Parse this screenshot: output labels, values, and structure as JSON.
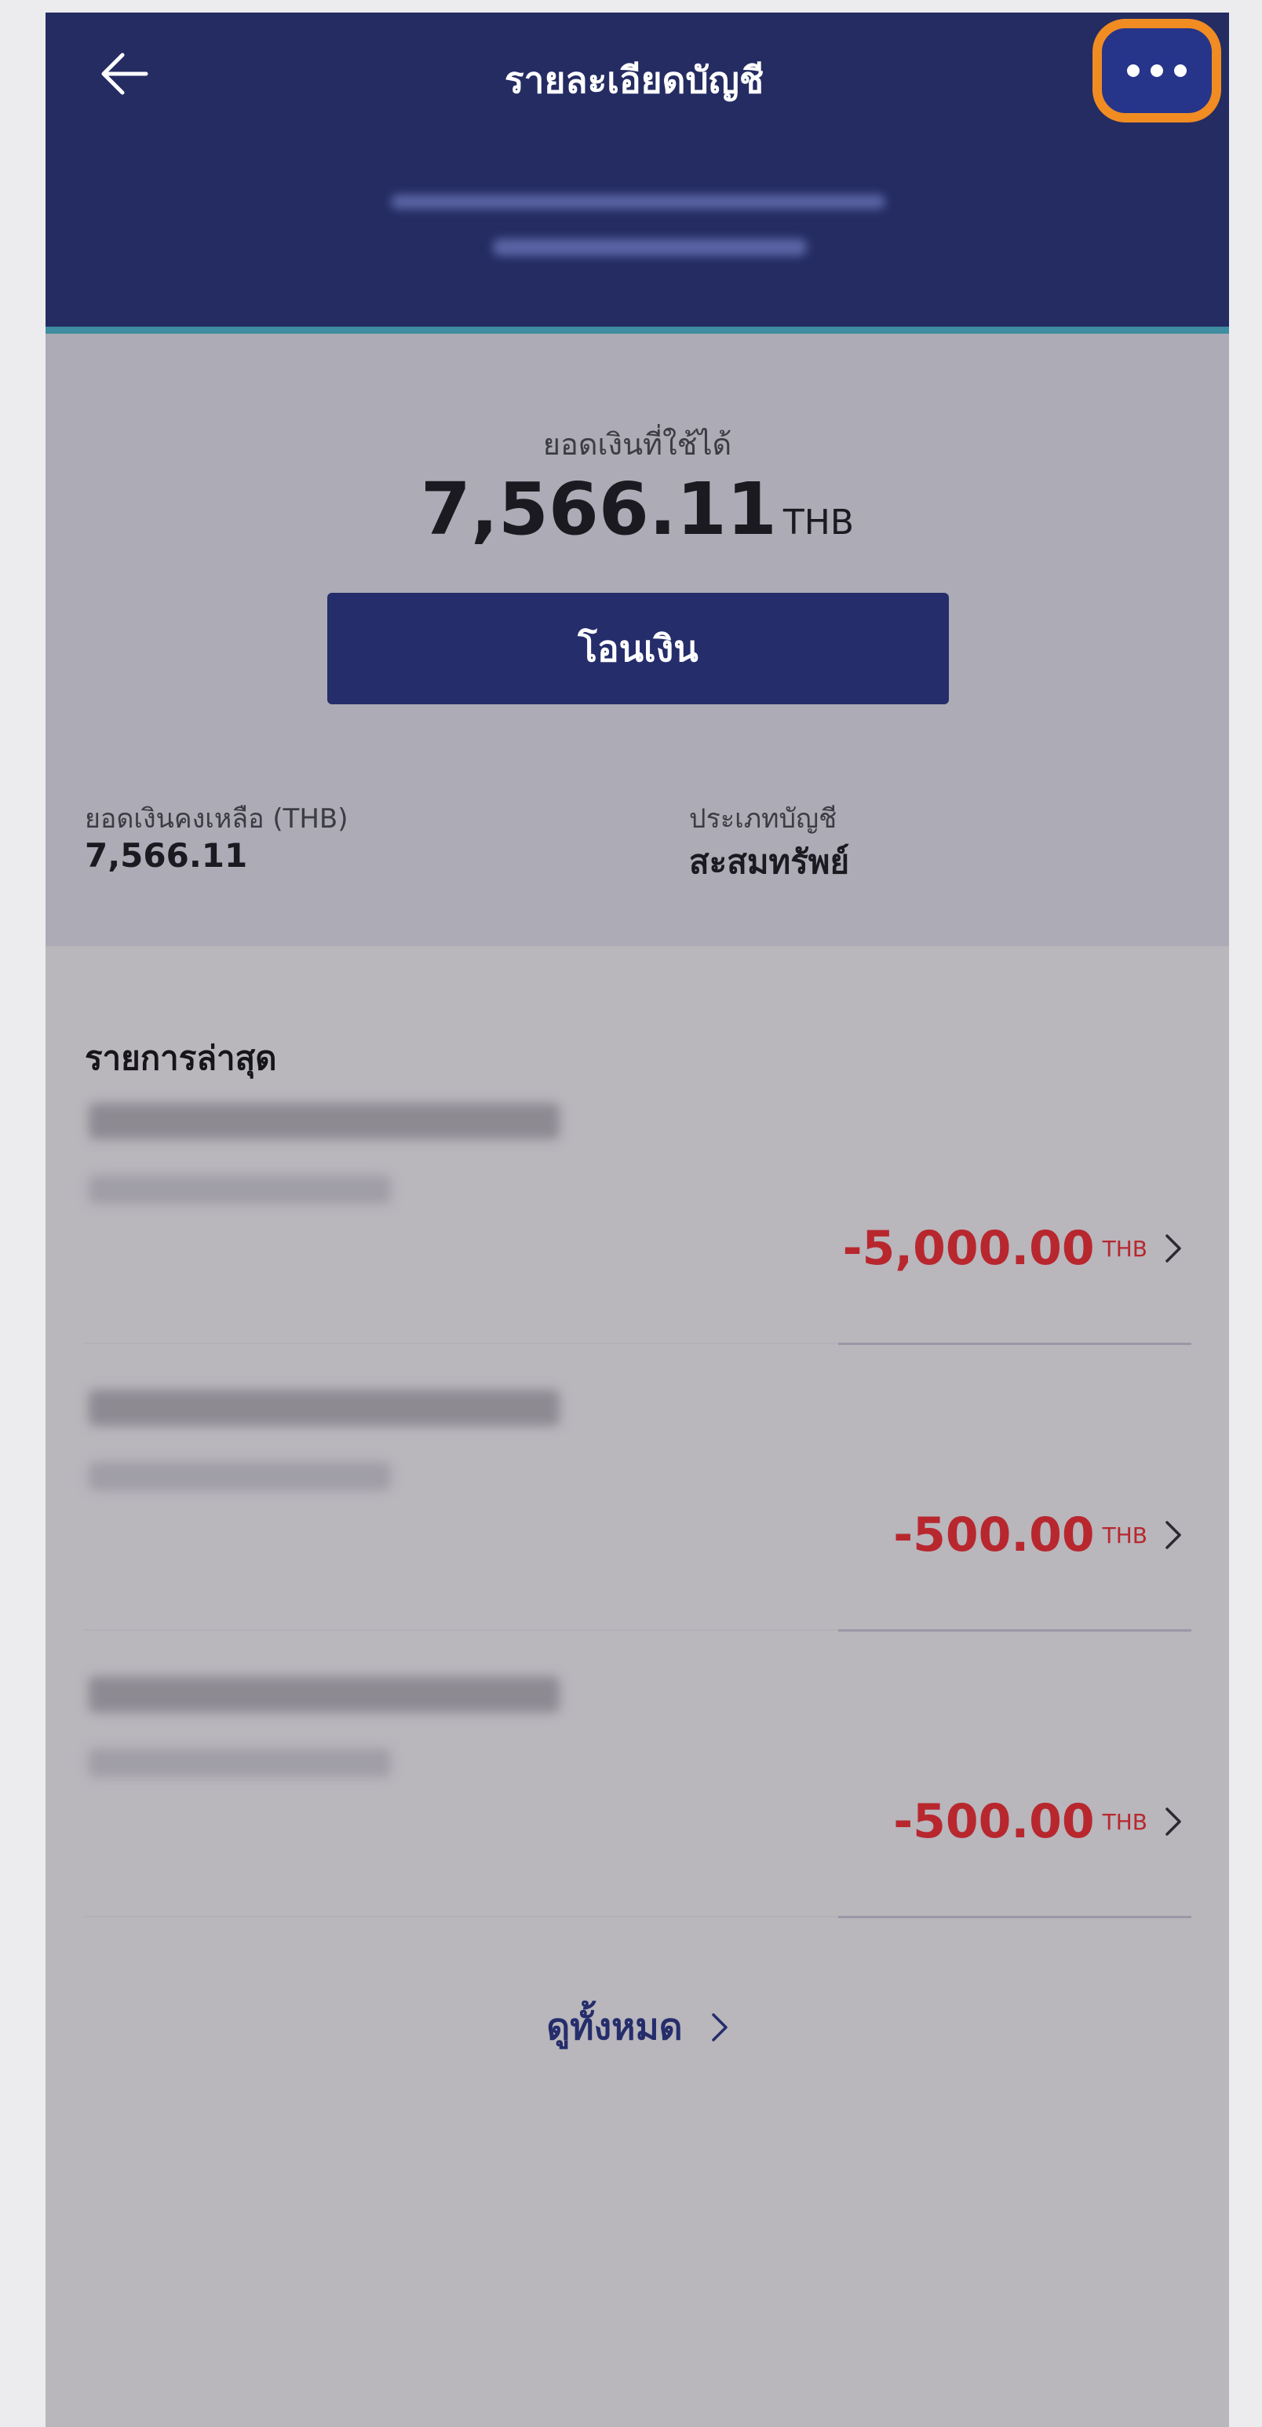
{
  "header": {
    "title": "รายละเอียดบัญชี",
    "back_icon": "arrow-left-icon",
    "more_icon": "more-horizontal-icon",
    "highlight_color": "#f08c22",
    "background_color": "#242c62"
  },
  "balance": {
    "available_label": "ยอดเงินที่ใช้ได้",
    "available_amount": "7,566.11",
    "available_currency": "THB",
    "transfer_button": "โอนเงิน",
    "remaining_label": "ยอดเงินคงเหลือ (THB)",
    "remaining_value": "7,566.11",
    "account_type_label": "ประเภทบัญชี",
    "account_type_value": "สะสมทรัพย์"
  },
  "transactions": {
    "title": "รายการล่าสุด",
    "items": [
      {
        "amount": "-5,000.00",
        "currency": "THB"
      },
      {
        "amount": "-500.00",
        "currency": "THB"
      },
      {
        "amount": "-500.00",
        "currency": "THB"
      }
    ],
    "amount_color": "#b8272e",
    "view_all": "ดูทั้งหมด"
  }
}
